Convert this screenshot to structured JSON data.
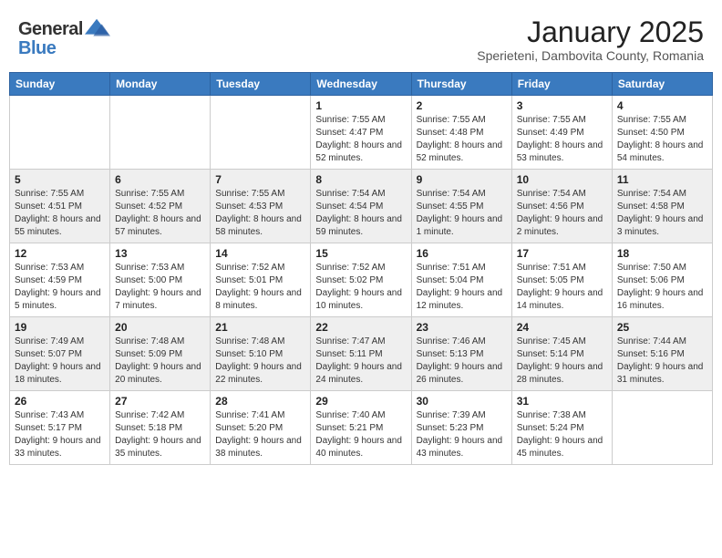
{
  "header": {
    "logo_general": "General",
    "logo_blue": "Blue",
    "month_title": "January 2025",
    "location": "Sperieteni, Dambovita County, Romania"
  },
  "weekdays": [
    "Sunday",
    "Monday",
    "Tuesday",
    "Wednesday",
    "Thursday",
    "Friday",
    "Saturday"
  ],
  "weeks": [
    [
      {
        "day": "",
        "info": ""
      },
      {
        "day": "",
        "info": ""
      },
      {
        "day": "",
        "info": ""
      },
      {
        "day": "1",
        "info": "Sunrise: 7:55 AM\nSunset: 4:47 PM\nDaylight: 8 hours and 52 minutes."
      },
      {
        "day": "2",
        "info": "Sunrise: 7:55 AM\nSunset: 4:48 PM\nDaylight: 8 hours and 52 minutes."
      },
      {
        "day": "3",
        "info": "Sunrise: 7:55 AM\nSunset: 4:49 PM\nDaylight: 8 hours and 53 minutes."
      },
      {
        "day": "4",
        "info": "Sunrise: 7:55 AM\nSunset: 4:50 PM\nDaylight: 8 hours and 54 minutes."
      }
    ],
    [
      {
        "day": "5",
        "info": "Sunrise: 7:55 AM\nSunset: 4:51 PM\nDaylight: 8 hours and 55 minutes."
      },
      {
        "day": "6",
        "info": "Sunrise: 7:55 AM\nSunset: 4:52 PM\nDaylight: 8 hours and 57 minutes."
      },
      {
        "day": "7",
        "info": "Sunrise: 7:55 AM\nSunset: 4:53 PM\nDaylight: 8 hours and 58 minutes."
      },
      {
        "day": "8",
        "info": "Sunrise: 7:54 AM\nSunset: 4:54 PM\nDaylight: 8 hours and 59 minutes."
      },
      {
        "day": "9",
        "info": "Sunrise: 7:54 AM\nSunset: 4:55 PM\nDaylight: 9 hours and 1 minute."
      },
      {
        "day": "10",
        "info": "Sunrise: 7:54 AM\nSunset: 4:56 PM\nDaylight: 9 hours and 2 minutes."
      },
      {
        "day": "11",
        "info": "Sunrise: 7:54 AM\nSunset: 4:58 PM\nDaylight: 9 hours and 3 minutes."
      }
    ],
    [
      {
        "day": "12",
        "info": "Sunrise: 7:53 AM\nSunset: 4:59 PM\nDaylight: 9 hours and 5 minutes."
      },
      {
        "day": "13",
        "info": "Sunrise: 7:53 AM\nSunset: 5:00 PM\nDaylight: 9 hours and 7 minutes."
      },
      {
        "day": "14",
        "info": "Sunrise: 7:52 AM\nSunset: 5:01 PM\nDaylight: 9 hours and 8 minutes."
      },
      {
        "day": "15",
        "info": "Sunrise: 7:52 AM\nSunset: 5:02 PM\nDaylight: 9 hours and 10 minutes."
      },
      {
        "day": "16",
        "info": "Sunrise: 7:51 AM\nSunset: 5:04 PM\nDaylight: 9 hours and 12 minutes."
      },
      {
        "day": "17",
        "info": "Sunrise: 7:51 AM\nSunset: 5:05 PM\nDaylight: 9 hours and 14 minutes."
      },
      {
        "day": "18",
        "info": "Sunrise: 7:50 AM\nSunset: 5:06 PM\nDaylight: 9 hours and 16 minutes."
      }
    ],
    [
      {
        "day": "19",
        "info": "Sunrise: 7:49 AM\nSunset: 5:07 PM\nDaylight: 9 hours and 18 minutes."
      },
      {
        "day": "20",
        "info": "Sunrise: 7:48 AM\nSunset: 5:09 PM\nDaylight: 9 hours and 20 minutes."
      },
      {
        "day": "21",
        "info": "Sunrise: 7:48 AM\nSunset: 5:10 PM\nDaylight: 9 hours and 22 minutes."
      },
      {
        "day": "22",
        "info": "Sunrise: 7:47 AM\nSunset: 5:11 PM\nDaylight: 9 hours and 24 minutes."
      },
      {
        "day": "23",
        "info": "Sunrise: 7:46 AM\nSunset: 5:13 PM\nDaylight: 9 hours and 26 minutes."
      },
      {
        "day": "24",
        "info": "Sunrise: 7:45 AM\nSunset: 5:14 PM\nDaylight: 9 hours and 28 minutes."
      },
      {
        "day": "25",
        "info": "Sunrise: 7:44 AM\nSunset: 5:16 PM\nDaylight: 9 hours and 31 minutes."
      }
    ],
    [
      {
        "day": "26",
        "info": "Sunrise: 7:43 AM\nSunset: 5:17 PM\nDaylight: 9 hours and 33 minutes."
      },
      {
        "day": "27",
        "info": "Sunrise: 7:42 AM\nSunset: 5:18 PM\nDaylight: 9 hours and 35 minutes."
      },
      {
        "day": "28",
        "info": "Sunrise: 7:41 AM\nSunset: 5:20 PM\nDaylight: 9 hours and 38 minutes."
      },
      {
        "day": "29",
        "info": "Sunrise: 7:40 AM\nSunset: 5:21 PM\nDaylight: 9 hours and 40 minutes."
      },
      {
        "day": "30",
        "info": "Sunrise: 7:39 AM\nSunset: 5:23 PM\nDaylight: 9 hours and 43 minutes."
      },
      {
        "day": "31",
        "info": "Sunrise: 7:38 AM\nSunset: 5:24 PM\nDaylight: 9 hours and 45 minutes."
      },
      {
        "day": "",
        "info": ""
      }
    ]
  ]
}
